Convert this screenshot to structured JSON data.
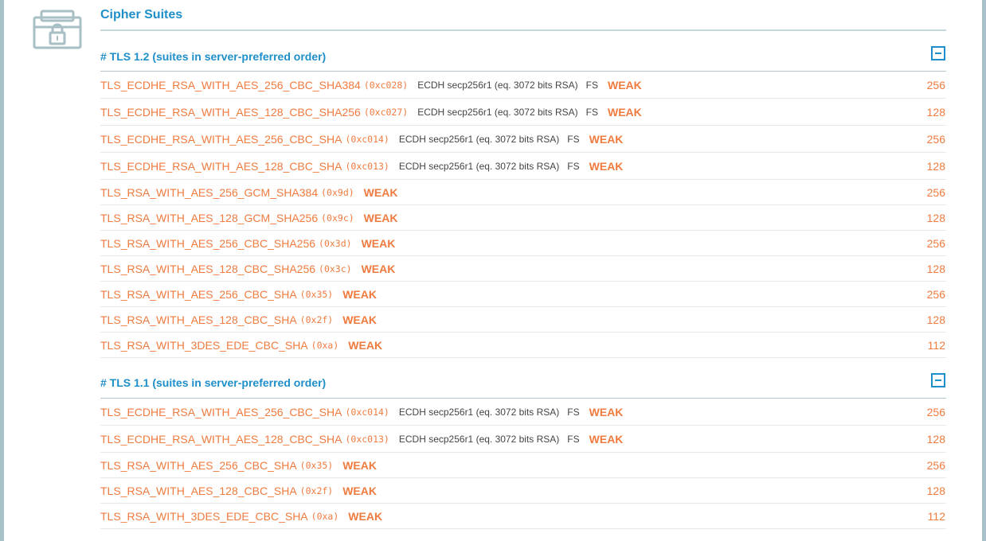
{
  "section": {
    "title": "Cipher Suites",
    "icon": "briefcase-lock-icon"
  },
  "colors": {
    "accent": "#1e8fc8",
    "weak": "#f07b3f",
    "text_muted": "#444444",
    "frame": "#a9c1c9"
  },
  "groups": [
    {
      "title": "# TLS 1.2 (suites in server-preferred order)",
      "rows": [
        {
          "name": "TLS_ECDHE_RSA_WITH_AES_256_CBC_SHA384",
          "code": "(0xc028)",
          "kex": "ECDH secp256r1 (eq. 3072 bits RSA)",
          "fs": "FS",
          "status": "WEAK",
          "bits": "256"
        },
        {
          "name": "TLS_ECDHE_RSA_WITH_AES_128_CBC_SHA256",
          "code": "(0xc027)",
          "kex": "ECDH secp256r1 (eq. 3072 bits RSA)",
          "fs": "FS",
          "status": "WEAK",
          "bits": "128"
        },
        {
          "name": "TLS_ECDHE_RSA_WITH_AES_256_CBC_SHA",
          "code": "(0xc014)",
          "kex": "ECDH secp256r1 (eq. 3072 bits RSA)",
          "fs": "FS",
          "status": "WEAK",
          "bits": "256"
        },
        {
          "name": "TLS_ECDHE_RSA_WITH_AES_128_CBC_SHA",
          "code": "(0xc013)",
          "kex": "ECDH secp256r1 (eq. 3072 bits RSA)",
          "fs": "FS",
          "status": "WEAK",
          "bits": "128"
        },
        {
          "name": "TLS_RSA_WITH_AES_256_GCM_SHA384",
          "code": "(0x9d)",
          "status": "WEAK",
          "bits": "256"
        },
        {
          "name": "TLS_RSA_WITH_AES_128_GCM_SHA256",
          "code": "(0x9c)",
          "status": "WEAK",
          "bits": "128"
        },
        {
          "name": "TLS_RSA_WITH_AES_256_CBC_SHA256",
          "code": "(0x3d)",
          "status": "WEAK",
          "bits": "256"
        },
        {
          "name": "TLS_RSA_WITH_AES_128_CBC_SHA256",
          "code": "(0x3c)",
          "status": "WEAK",
          "bits": "128"
        },
        {
          "name": "TLS_RSA_WITH_AES_256_CBC_SHA",
          "code": "(0x35)",
          "status": "WEAK",
          "bits": "256"
        },
        {
          "name": "TLS_RSA_WITH_AES_128_CBC_SHA",
          "code": "(0x2f)",
          "status": "WEAK",
          "bits": "128"
        },
        {
          "name": "TLS_RSA_WITH_3DES_EDE_CBC_SHA",
          "code": "(0xa)",
          "status": "WEAK",
          "bits": "112"
        }
      ]
    },
    {
      "title": "# TLS 1.1 (suites in server-preferred order)",
      "rows": [
        {
          "name": "TLS_ECDHE_RSA_WITH_AES_256_CBC_SHA",
          "code": "(0xc014)",
          "kex": "ECDH secp256r1 (eq. 3072 bits RSA)",
          "fs": "FS",
          "status": "WEAK",
          "bits": "256"
        },
        {
          "name": "TLS_ECDHE_RSA_WITH_AES_128_CBC_SHA",
          "code": "(0xc013)",
          "kex": "ECDH secp256r1 (eq. 3072 bits RSA)",
          "fs": "FS",
          "status": "WEAK",
          "bits": "128"
        },
        {
          "name": "TLS_RSA_WITH_AES_256_CBC_SHA",
          "code": "(0x35)",
          "status": "WEAK",
          "bits": "256"
        },
        {
          "name": "TLS_RSA_WITH_AES_128_CBC_SHA",
          "code": "(0x2f)",
          "status": "WEAK",
          "bits": "128"
        },
        {
          "name": "TLS_RSA_WITH_3DES_EDE_CBC_SHA",
          "code": "(0xa)",
          "status": "WEAK",
          "bits": "112"
        }
      ]
    }
  ]
}
